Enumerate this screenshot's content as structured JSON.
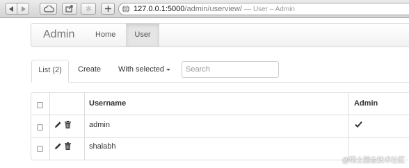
{
  "browser": {
    "url_host": "127.0.0.1:5000",
    "url_path": "/admin/userview/",
    "title_separator": "—",
    "page_title": "User – Admin",
    "buttons": [
      "back-icon",
      "forward-icon",
      "cloud-icon",
      "share-icon",
      "puzzle-icon",
      "plus-icon"
    ]
  },
  "navbar": {
    "brand": "Admin",
    "items": [
      {
        "label": "Home",
        "active": false
      },
      {
        "label": "User",
        "active": true
      }
    ]
  },
  "tabs": {
    "list_label": "List (2)",
    "create_label": "Create",
    "with_selected_label": "With selected"
  },
  "search": {
    "placeholder": "Search"
  },
  "table": {
    "columns": [
      "",
      "",
      "Username",
      "Admin"
    ],
    "rows": [
      {
        "username": "admin",
        "admin_icon": "check-icon"
      },
      {
        "username": "shalabh",
        "admin_icon": ""
      }
    ]
  },
  "watermark": {
    "text": "@稀土掘金技术社区"
  },
  "colors": {
    "toolbar_bg": "#d9d9d9",
    "navbar_active_bg": "#e5e5e5",
    "border": "#dddddd"
  }
}
